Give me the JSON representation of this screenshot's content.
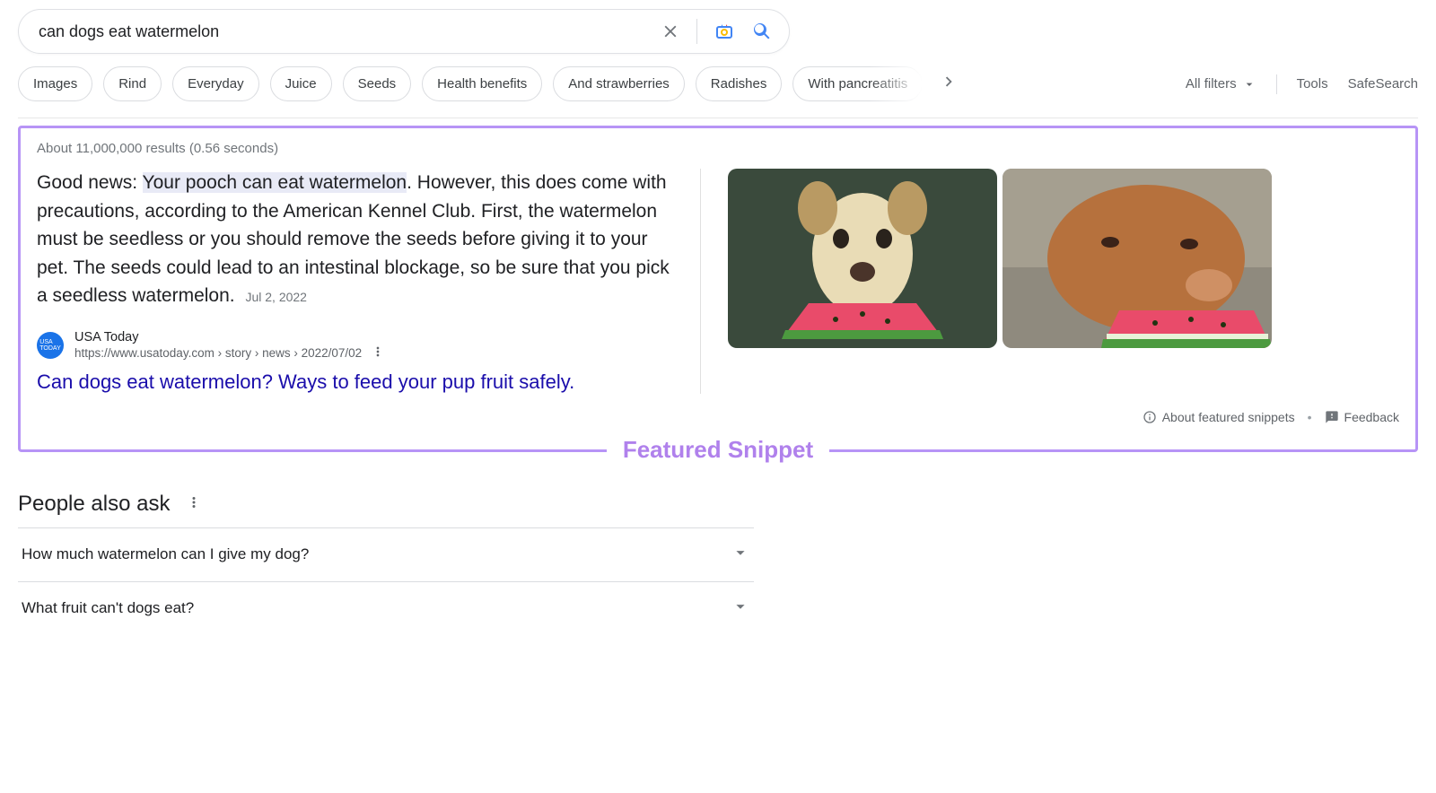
{
  "search": {
    "query": "can dogs eat watermelon"
  },
  "chips": [
    "Images",
    "Rind",
    "Everyday",
    "Juice",
    "Seeds",
    "Health benefits",
    "And strawberries",
    "Radishes",
    "With pancreatitis"
  ],
  "tools": {
    "all_filters": "All filters",
    "tools": "Tools",
    "safesearch": "SafeSearch"
  },
  "result_stats": "About 11,000,000 results (0.56 seconds)",
  "snippet": {
    "pre_hl": "Good news: ",
    "hl": "Your pooch can eat watermelon",
    "post_hl": ". However, this does come with precautions, according to the American Kennel Club. First, the watermelon must be seedless or you should remove the seeds before giving it to your pet. The seeds could lead to an intestinal blockage, so be sure that you pick a seedless watermelon.",
    "date": "Jul 2, 2022",
    "source_site": "USA Today",
    "source_path": "https://www.usatoday.com › story › news › 2022/07/02",
    "source_title": "Can dogs eat watermelon? Ways to feed your pup fruit safely."
  },
  "featured_label": "Featured Snippet",
  "feedback": {
    "about": "About featured snippets",
    "feedback": "Feedback"
  },
  "paa": {
    "heading": "People also ask",
    "items": [
      "How much watermelon can I give my dog?",
      "What fruit can't dogs eat?"
    ]
  }
}
